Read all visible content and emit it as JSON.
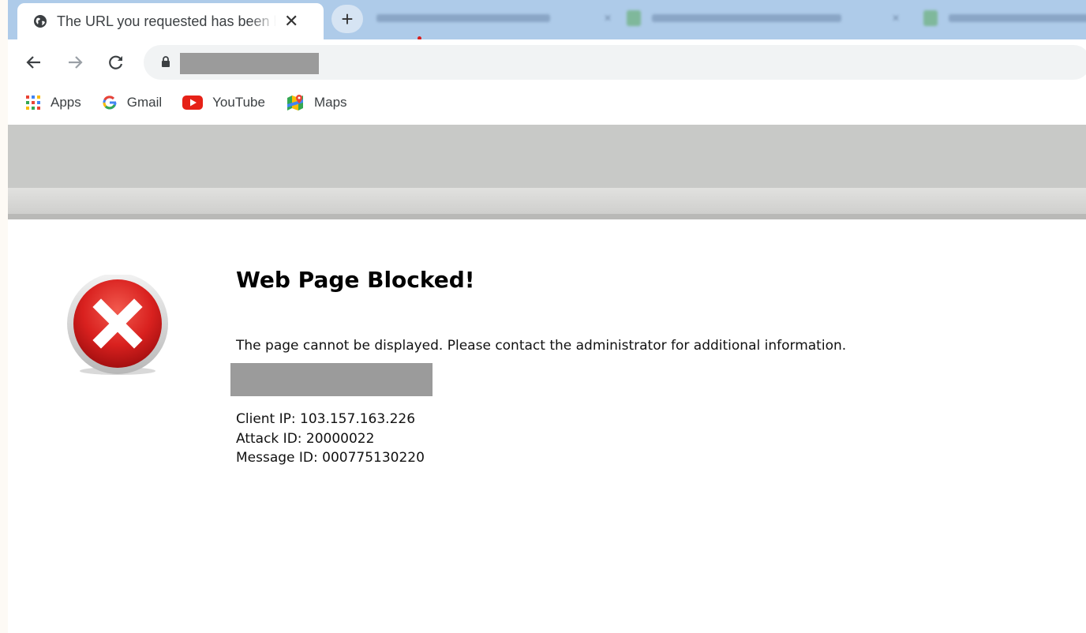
{
  "browser": {
    "active_tab": {
      "title": "The URL you requested has been blocked",
      "close_glyph": "✕",
      "favicon": "globe-icon"
    },
    "new_tab_glyph": "+",
    "background_tab_glyph": "✕",
    "nav": {
      "back_icon": "back-arrow-icon",
      "forward_icon": "forward-arrow-icon",
      "reload_icon": "reload-icon",
      "lock_icon": "lock-icon"
    }
  },
  "bookmarks": [
    {
      "label": "Apps",
      "icon": "apps-grid-icon"
    },
    {
      "label": "Gmail",
      "icon": "google-g-icon"
    },
    {
      "label": "YouTube",
      "icon": "youtube-icon"
    },
    {
      "label": "Maps",
      "icon": "maps-icon"
    }
  ],
  "page": {
    "heading": "Web Page Blocked!",
    "message": "The page cannot be displayed. Please contact the administrator for additional information.",
    "client_ip": "Client IP: 103.157.163.226",
    "attack_id": "Attack ID: 20000022",
    "message_id": "Message ID: 000775130220",
    "error_icon": "error-x-icon"
  },
  "colors": {
    "tabstrip": "#aecbe9",
    "error_red": "#d9211f",
    "redaction": "#9b9b9b"
  }
}
